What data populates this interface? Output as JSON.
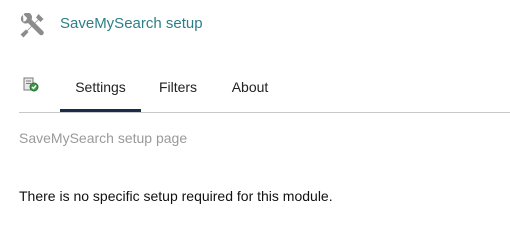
{
  "header": {
    "icon": "tools-icon",
    "title": "SaveMySearch setup"
  },
  "tabs": {
    "module_icon": "module-icon",
    "items": [
      {
        "label": "Settings",
        "active": true
      },
      {
        "label": "Filters",
        "active": false
      },
      {
        "label": "About",
        "active": false
      }
    ]
  },
  "content": {
    "subtitle": "SaveMySearch setup page",
    "message": "There is no specific setup required for this module."
  },
  "colors": {
    "title": "#2c7f87",
    "active_tab_underline": "#1b2c4a",
    "subtitle": "#9a9a9a"
  }
}
